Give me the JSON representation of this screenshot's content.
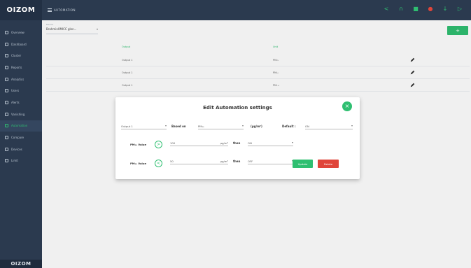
{
  "brand": {
    "logo_text": "OIZOM",
    "footer_text": "OIZOM"
  },
  "topbar": {
    "title": "AUTOMATION",
    "icons": [
      "share-icon",
      "headset-icon",
      "grid-icon",
      "alert-pin-icon",
      "download-icon",
      "logout-icon"
    ]
  },
  "sidebar": {
    "items": [
      {
        "label": "Overview",
        "icon": "pin-icon"
      },
      {
        "label": "Dashboard",
        "icon": "dashboard-icon"
      },
      {
        "label": "Cluster",
        "icon": "cluster-icon"
      },
      {
        "label": "Reports",
        "icon": "reports-icon"
      },
      {
        "label": "Analytics",
        "icon": "analytics-icon"
      },
      {
        "label": "Users",
        "icon": "users-icon"
      },
      {
        "label": "Alerts",
        "icon": "bell-icon"
      },
      {
        "label": "Vanishing",
        "icon": "vanish-icon"
      },
      {
        "label": "Automation",
        "icon": "automation-icon",
        "active": true
      },
      {
        "label": "Compare",
        "icon": "compare-icon"
      },
      {
        "label": "Devices",
        "icon": "devices-icon"
      },
      {
        "label": "Limit",
        "icon": "limit-icon"
      }
    ]
  },
  "device": {
    "label": "Device",
    "value": "Brahmin0MICC glen..."
  },
  "add_button_label": "+",
  "table": {
    "headers": {
      "output": "Output",
      "unit": "Unit"
    },
    "rows": [
      {
        "output": "Output 1",
        "unit": "PM₂₅"
      },
      {
        "output": "Output 1",
        "unit": "PM₁₀"
      },
      {
        "output": "Output 1",
        "unit": "PM₁.₀"
      }
    ]
  },
  "modal": {
    "title": "Edit Automation settings",
    "output_select": "Output 1",
    "based_on_label": "Based on",
    "based_on_value": "PM₂₅",
    "unit_value": "(µg/m³)",
    "default_label": "Default :",
    "default_value": "ON",
    "rule1": {
      "label": "PM₂₅ Value",
      "value": "100",
      "unit": "µg/m³",
      "then_label": "then",
      "state": "ON",
      "op_icon": ">"
    },
    "rule2": {
      "label": "PM₂₅ Value",
      "value": "50",
      "unit": "µg/m³",
      "then_label": "then",
      "state": "OFF",
      "op_icon": "<"
    },
    "update_label": "Update",
    "delete_label": "Delete",
    "close_icon": "×"
  },
  "colors": {
    "accent": "#2fbf71",
    "sidebar": "#2b3a4f",
    "danger": "#e0453a"
  }
}
